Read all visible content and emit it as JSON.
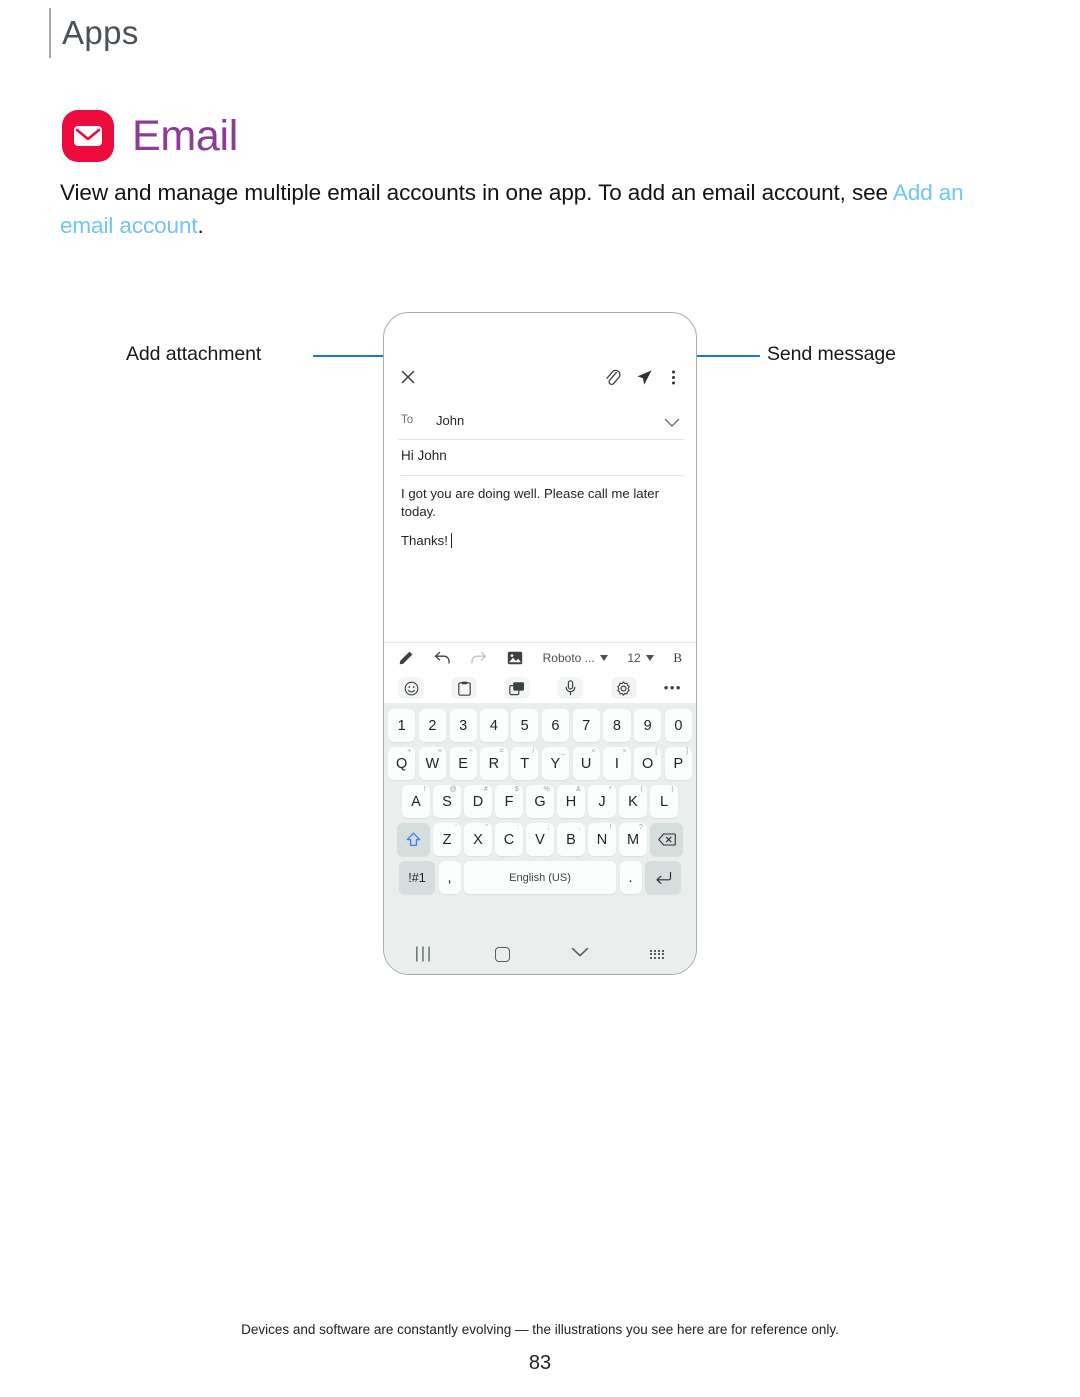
{
  "header": {
    "section_title": "Apps"
  },
  "app": {
    "icon_name": "email-envelope-icon",
    "title": "Email",
    "icon_color": "#ed0b3c",
    "title_color": "#8c3b96"
  },
  "description": {
    "text_before": "View and manage multiple email accounts in one app. To add an email account, see ",
    "link_text": "Add an email account",
    "text_after": "."
  },
  "callouts": {
    "left_label": "Add attachment",
    "right_label": "Send message",
    "line_color": "#1a73e8"
  },
  "phone": {
    "appbar": {
      "close_icon": "close-x-icon",
      "attach_icon": "paperclip-icon",
      "send_icon": "send-paper-plane-icon",
      "more_icon": "more-vertical-icon"
    },
    "compose": {
      "to_label": "To",
      "to_value": "John",
      "expand_icon": "chevron-down-icon",
      "subject": "Hi John",
      "body_line1": "I got you are doing well. Please call me later today.",
      "body_line2": "Thanks!"
    },
    "toolbar_row1": [
      {
        "name": "pen-icon",
        "label": ""
      },
      {
        "name": "undo-icon",
        "label": ""
      },
      {
        "name": "redo-icon",
        "label": ""
      },
      {
        "name": "image-icon",
        "label": ""
      },
      {
        "name": "font-family-dropdown",
        "label": "Roboto ..."
      },
      {
        "name": "font-size-dropdown",
        "label": "12"
      },
      {
        "name": "bold-button",
        "label": "B"
      }
    ],
    "toolbar_row2": [
      {
        "name": "emoji-icon",
        "label": ""
      },
      {
        "name": "clipboard-icon",
        "label": ""
      },
      {
        "name": "sticker-icon",
        "label": ""
      },
      {
        "name": "microphone-icon",
        "label": ""
      },
      {
        "name": "settings-gear-icon",
        "label": ""
      },
      {
        "name": "more-horizontal-icon",
        "label": ""
      }
    ],
    "keyboard": {
      "row_numbers": [
        "1",
        "2",
        "3",
        "4",
        "5",
        "6",
        "7",
        "8",
        "9",
        "0"
      ],
      "row_top": [
        {
          "key": "Q",
          "sup": "+"
        },
        {
          "key": "W",
          "sup": "×"
        },
        {
          "key": "E",
          "sup": "÷"
        },
        {
          "key": "R",
          "sup": "="
        },
        {
          "key": "T",
          "sup": "/"
        },
        {
          "key": "Y",
          "sup": "_"
        },
        {
          "key": "U",
          "sup": "<"
        },
        {
          "key": "I",
          "sup": ">"
        },
        {
          "key": "O",
          "sup": "["
        },
        {
          "key": "P",
          "sup": "]"
        }
      ],
      "row_home": [
        {
          "key": "A",
          "sup": "!"
        },
        {
          "key": "S",
          "sup": "@"
        },
        {
          "key": "D",
          "sup": "#"
        },
        {
          "key": "F",
          "sup": "$"
        },
        {
          "key": "G",
          "sup": "%"
        },
        {
          "key": "H",
          "sup": "&"
        },
        {
          "key": "J",
          "sup": "*"
        },
        {
          "key": "K",
          "sup": "("
        },
        {
          "key": "L",
          "sup": ")"
        }
      ],
      "row_bottom": [
        {
          "key": "Z",
          "sup": "'"
        },
        {
          "key": "X",
          "sup": "\""
        },
        {
          "key": "C",
          "sup": ":"
        },
        {
          "key": "V",
          "sup": ";"
        },
        {
          "key": "B",
          "sup": ","
        },
        {
          "key": "N",
          "sup": "!"
        },
        {
          "key": "M",
          "sup": "?"
        }
      ],
      "shift_icon": "shift-up-arrow-icon",
      "backspace_icon": "backspace-icon",
      "symbols_key": "!#1",
      "comma_key": ",",
      "space_key": "English (US)",
      "period_key": ".",
      "enter_icon": "enter-return-icon"
    },
    "navbar": {
      "recent_icon": "recent-apps-icon",
      "home_icon": "home-icon",
      "hide_keyboard_icon": "chevron-down-icon",
      "keyboard_switch_icon": "keyboard-icon"
    }
  },
  "footer": {
    "note": "Devices and software are constantly evolving — the illustrations you see here are for reference only.",
    "page_number": "83"
  }
}
